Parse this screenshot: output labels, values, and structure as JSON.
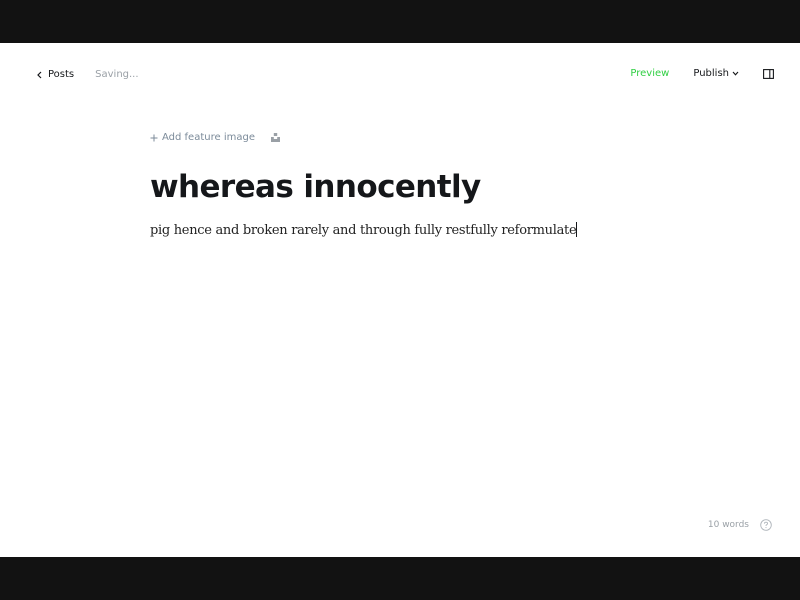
{
  "nav": {
    "back_label": "Posts",
    "status": "Saving...",
    "preview_label": "Preview",
    "publish_label": "Publish"
  },
  "feature": {
    "add_label": "Add feature image"
  },
  "post": {
    "title": "whereas innocently",
    "body": "pig hence and broken rarely and through fully restfully reformulate"
  },
  "footer": {
    "word_count": "10 words"
  },
  "colors": {
    "accent_green": "#30cf43",
    "text_dark": "#15171a",
    "text_muted": "#9aa0a6",
    "frame": "#121212"
  },
  "icons": [
    "chevron-left-icon",
    "chevron-down-icon",
    "sidebar-icon",
    "plus-icon",
    "unsplash-icon",
    "help-icon"
  ]
}
